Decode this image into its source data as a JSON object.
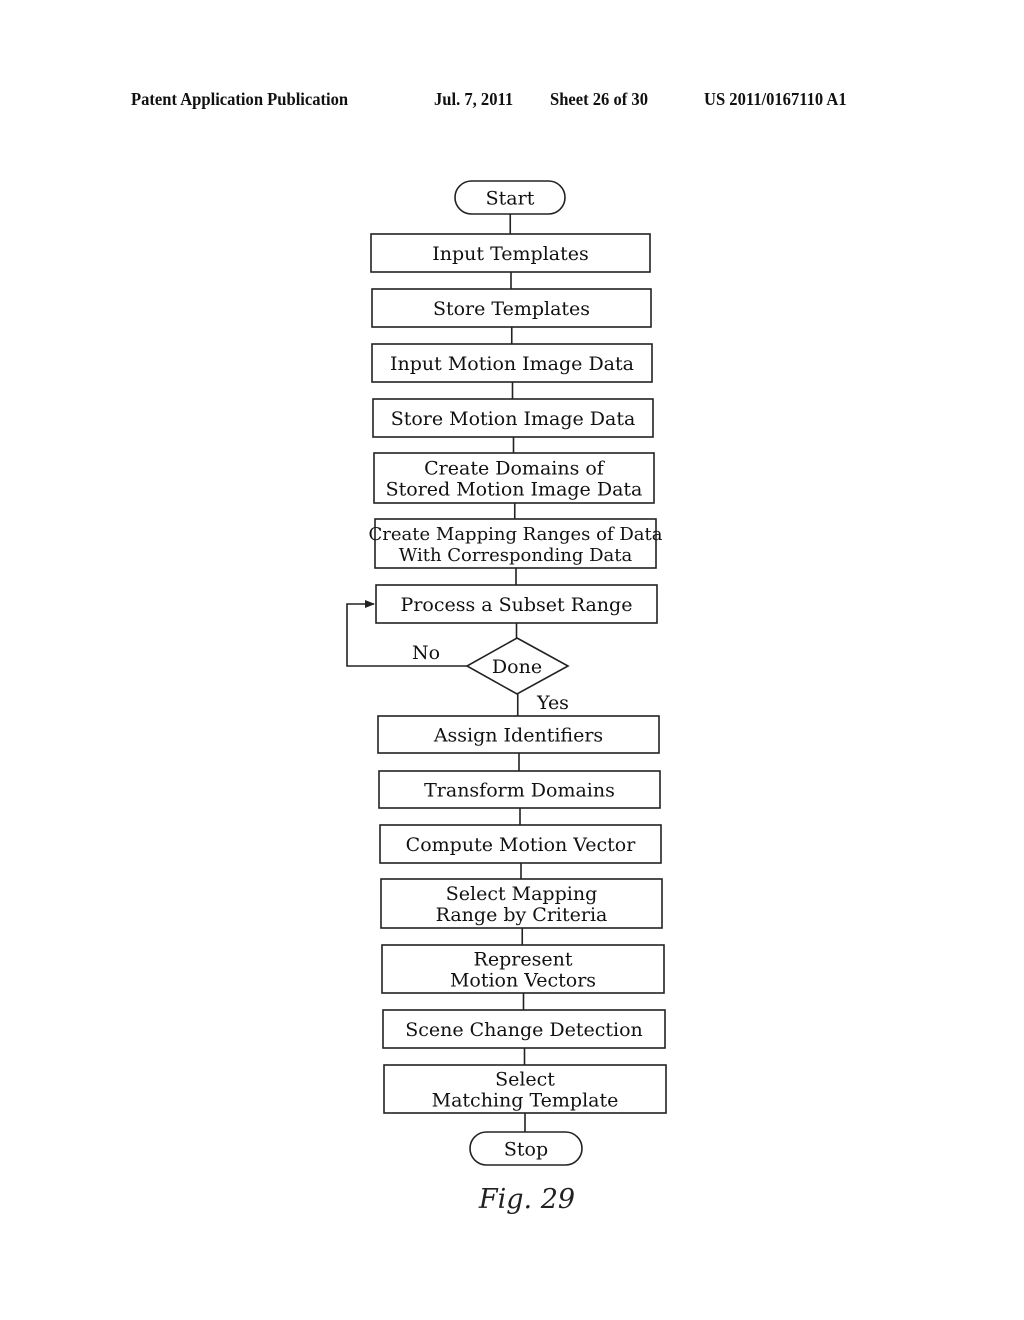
{
  "header": {
    "publication": "Patent Application Publication",
    "date": "Jul. 7, 2011",
    "sheet": "Sheet 26 of 30",
    "number": "US 2011/0167110 A1"
  },
  "flowchart": {
    "start": "Start",
    "steps": [
      {
        "lines": [
          "Input Templates"
        ]
      },
      {
        "lines": [
          "Store Templates"
        ]
      },
      {
        "lines": [
          "Input Motion Image Data"
        ]
      },
      {
        "lines": [
          "Store Motion Image Data"
        ]
      },
      {
        "lines": [
          "Create Domains of",
          "Stored Motion Image Data"
        ]
      },
      {
        "lines": [
          "Create Mapping Ranges of Data",
          "With Corresponding Data"
        ]
      },
      {
        "lines": [
          "Process a Subset Range"
        ]
      }
    ],
    "decision": {
      "label": "Done",
      "no_label": "No",
      "yes_label": "Yes"
    },
    "steps_after": [
      {
        "lines": [
          "Assign Identifiers"
        ]
      },
      {
        "lines": [
          "Transform Domains"
        ]
      },
      {
        "lines": [
          "Compute Motion Vector"
        ]
      },
      {
        "lines": [
          "Select Mapping",
          "Range by Criteria"
        ]
      },
      {
        "lines": [
          "Represent",
          "Motion Vectors"
        ]
      },
      {
        "lines": [
          "Scene Change Detection"
        ]
      },
      {
        "lines": [
          "Select",
          "Matching Template"
        ]
      }
    ],
    "stop": "Stop"
  },
  "figure_label": "Fig. 29"
}
